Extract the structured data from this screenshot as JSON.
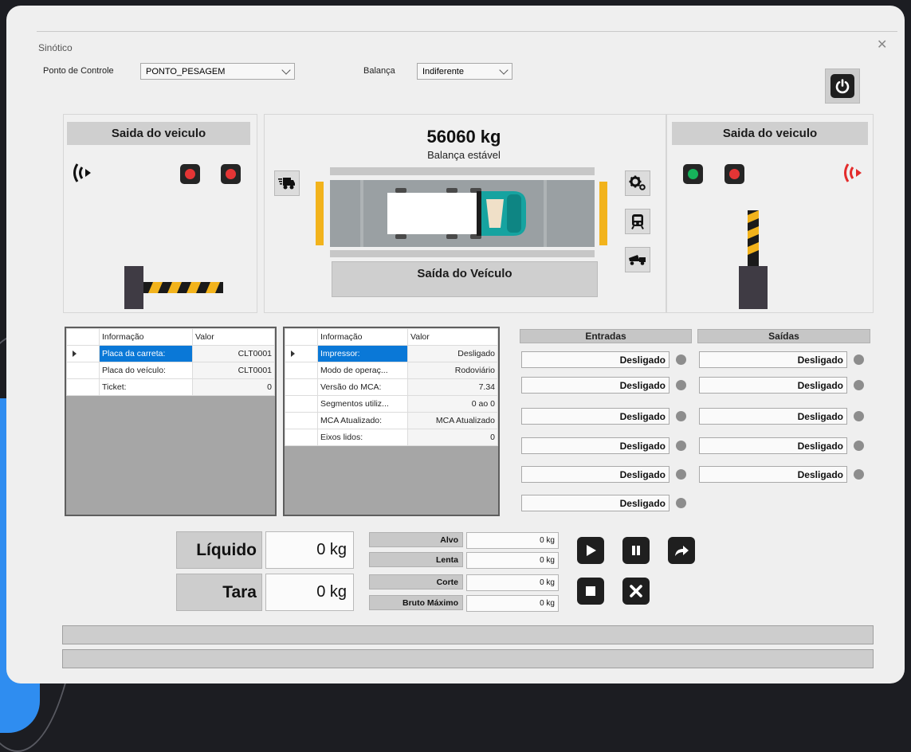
{
  "window": {
    "title": "Sinótico",
    "close_glyph": "✕"
  },
  "top": {
    "ponto_label": "Ponto de Controle",
    "ponto_value": "PONTO_PESAGEM",
    "balanca_label": "Balança",
    "balanca_value": "Indiferente"
  },
  "left_gate": {
    "title": "Saida do veiculo",
    "lamps": [
      "red",
      "red"
    ],
    "antenna_color": "#111111"
  },
  "right_gate": {
    "title": "Saida do veiculo",
    "lamps": [
      "green",
      "red"
    ],
    "antenna_color": "#e32b2b"
  },
  "scale": {
    "weight": "56060 kg",
    "status": "Balança estável",
    "exit_button": "Saída do Veículo"
  },
  "icons": {
    "power": "power-icon",
    "truck": "truck-icon",
    "settings": "gears-icon",
    "train": "train-icon",
    "dump_truck": "dump-truck-icon",
    "play": "play-icon",
    "pause": "pause-icon",
    "forward": "forward-icon",
    "stop": "stop-icon",
    "cancel": "cancel-icon"
  },
  "grid1": {
    "headers": [
      "Informação",
      "Valor"
    ],
    "rows": [
      {
        "k": "Placa da carreta:",
        "v": "CLT0001"
      },
      {
        "k": "Placa do veículo:",
        "v": "CLT0001"
      },
      {
        "k": "Ticket:",
        "v": "0"
      }
    ]
  },
  "grid2": {
    "headers": [
      "Informação",
      "Valor"
    ],
    "rows": [
      {
        "k": "Impressor:",
        "v": "Desligado"
      },
      {
        "k": "Modo de operaç...",
        "v": "Rodoviário"
      },
      {
        "k": "Versão do MCA:",
        "v": "7.34"
      },
      {
        "k": "Segmentos utiliz...",
        "v": "0 ao 0"
      },
      {
        "k": "MCA Atualizado:",
        "v": "MCA Atualizado"
      },
      {
        "k": "Eixos lidos:",
        "v": "0"
      }
    ]
  },
  "io": {
    "entradas_label": "Entradas",
    "saidas_label": "Saídas",
    "entradas": [
      "Desligado",
      "Desligado",
      "Desligado",
      "Desligado",
      "Desligado",
      "Desligado"
    ],
    "saidas": [
      "Desligado",
      "Desligado",
      "Desligado",
      "Desligado",
      "Desligado"
    ]
  },
  "totals": {
    "liquido_label": "Líquido",
    "liquido_value": "0 kg",
    "tara_label": "Tara",
    "tara_value": "0 kg"
  },
  "targets": [
    {
      "label": "Alvo",
      "value": "0 kg"
    },
    {
      "label": "Lenta",
      "value": "0 kg"
    },
    {
      "label": "Corte",
      "value": "0 kg"
    },
    {
      "label": "Bruto Máximo",
      "value": "0 kg"
    }
  ],
  "colors": {
    "red": "#e53535",
    "green": "#16b25a",
    "selected": "#0a78d7",
    "yellow": "#f2b31c"
  }
}
